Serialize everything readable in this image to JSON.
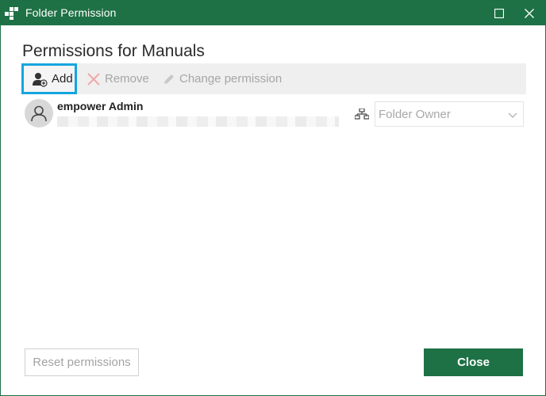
{
  "window": {
    "title": "Folder Permission"
  },
  "heading": "Permissions for Manuals",
  "toolbar": {
    "add_label": "Add",
    "remove_label": "Remove",
    "change_label": "Change permission"
  },
  "users": [
    {
      "name": "empower Admin",
      "role": "Folder Owner"
    }
  ],
  "footer": {
    "reset_label": "Reset permissions",
    "close_label": "Close"
  },
  "colors": {
    "title_bar": "#1e7145",
    "accent_highlight": "#14a6de",
    "disabled_text": "#a6a6a6"
  },
  "icons": {
    "app": "app-logo-icon",
    "maximize": "maximize-icon",
    "close": "close-icon",
    "add": "add-user-icon",
    "remove": "remove-x-icon",
    "change": "pencil-icon",
    "avatar": "user-avatar-icon",
    "role": "hierarchy-icon",
    "dropdown": "chevron-down-icon"
  }
}
